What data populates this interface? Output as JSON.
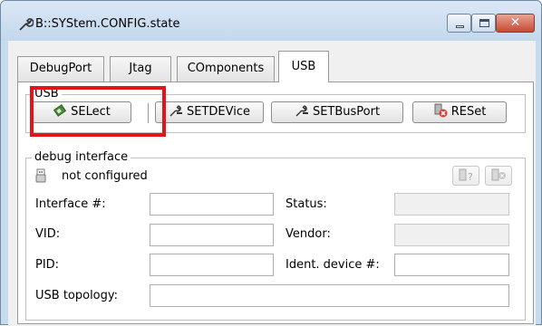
{
  "window": {
    "title": "B::SYStem.CONFIG.state",
    "controls": {
      "minimize": "minimize",
      "maximize": "maximize",
      "close": "✕"
    }
  },
  "tabs": [
    {
      "label": "DebugPort",
      "active": false
    },
    {
      "label": "Jtag",
      "active": false
    },
    {
      "label": "COmponents",
      "active": false
    },
    {
      "label": "USB",
      "active": true
    }
  ],
  "usb_group": {
    "label": "USB",
    "buttons": {
      "select": "SELect",
      "setdevice": "SETDEVice",
      "setbusport": "SETBusPort",
      "reset": "RESet"
    }
  },
  "debug_interface": {
    "label": "debug interface",
    "status_text": "not configured",
    "fields": {
      "interface_label": "Interface #:",
      "interface_value": "",
      "status_label": "Status:",
      "status_value": "",
      "vid_label": "VID:",
      "vid_value": "",
      "vendor_label": "Vendor:",
      "vendor_value": "",
      "pid_label": "PID:",
      "pid_value": "",
      "ident_label": "Ident. device #:",
      "ident_value": "",
      "topology_label": "USB topology:",
      "topology_value": ""
    }
  },
  "colors": {
    "highlight": "#e2151b",
    "title_bar": "#c7dbef",
    "close_button": "#c64a33"
  }
}
